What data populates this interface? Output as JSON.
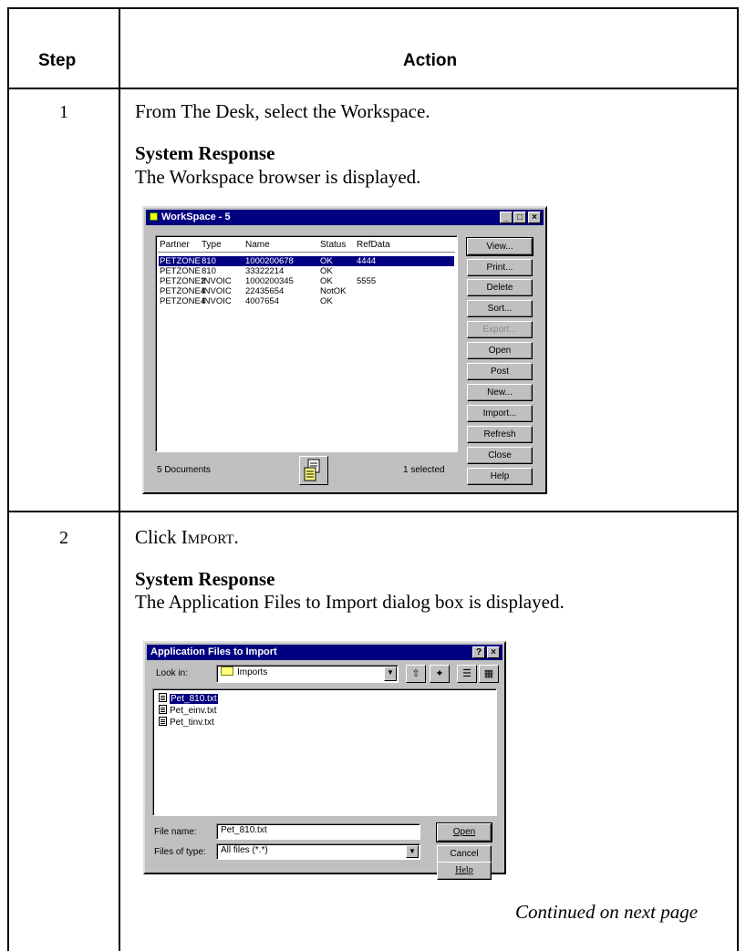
{
  "table": {
    "header_step": "Step",
    "header_action": "Action",
    "continued": "Continued on next page"
  },
  "step1": {
    "number": "1",
    "instruction": "From The Desk, select the Workspace.",
    "response_heading": "System Response",
    "response_text": "The Workspace browser is displayed."
  },
  "step2": {
    "number": "2",
    "instruction_prefix": "Click ",
    "instruction_action": "Import",
    "instruction_suffix": ".",
    "response_heading": "System Response",
    "response_text": "The Application Files to Import dialog box is displayed."
  },
  "workspace": {
    "title": "WorkSpace - 5",
    "columns": [
      "Partner",
      "Type",
      "Name",
      "Status",
      "RefData"
    ],
    "rows": [
      {
        "partner": "PETZONE",
        "type": "810",
        "name": "1000200678",
        "status": "OK",
        "refdata": "4444",
        "selected": true
      },
      {
        "partner": "PETZONE",
        "type": "810",
        "name": "33322214",
        "status": "OK",
        "refdata": "",
        "selected": false
      },
      {
        "partner": "PETZONE2",
        "type": "INVOIC",
        "name": "1000200345",
        "status": "OK",
        "refdata": "5555",
        "selected": false
      },
      {
        "partner": "PETZONE4",
        "type": "INVOIC",
        "name": "22435654",
        "status": "NotOK",
        "refdata": "",
        "selected": false
      },
      {
        "partner": "PETZONE4",
        "type": "INVOIC",
        "name": "4007654",
        "status": "OK",
        "refdata": "",
        "selected": false
      }
    ],
    "doc_count": "5 Documents",
    "selected_count": "1 selected",
    "buttons": {
      "view": "View...",
      "print": "Print...",
      "delete": "Delete",
      "sort": "Sort...",
      "export": "Export...",
      "open": "Open",
      "post": "Post",
      "new": "New...",
      "import": "Import...",
      "refresh": "Refresh",
      "close": "Close",
      "help": "Help"
    },
    "icons": {
      "app": "workspace-app-icon",
      "document": "document-stack-icon"
    }
  },
  "import_dialog": {
    "title": "Application Files to Import",
    "look_in_label": "Look in:",
    "look_in_value": "Imports",
    "files": [
      "Pet_810.txt",
      "Pet_einv.txt",
      "Pet_tinv.txt"
    ],
    "selected_file": "Pet_810.txt",
    "file_name_label": "File name:",
    "file_name_value": "Pet_810.txt",
    "files_of_type_label": "Files of type:",
    "files_of_type_value": "All files (*.*)",
    "buttons": {
      "open": "Open",
      "cancel": "Cancel",
      "help": "Help"
    }
  },
  "colors": {
    "title_bar": "#000080",
    "window_face": "#c0c0c0",
    "selection": "#000080"
  }
}
